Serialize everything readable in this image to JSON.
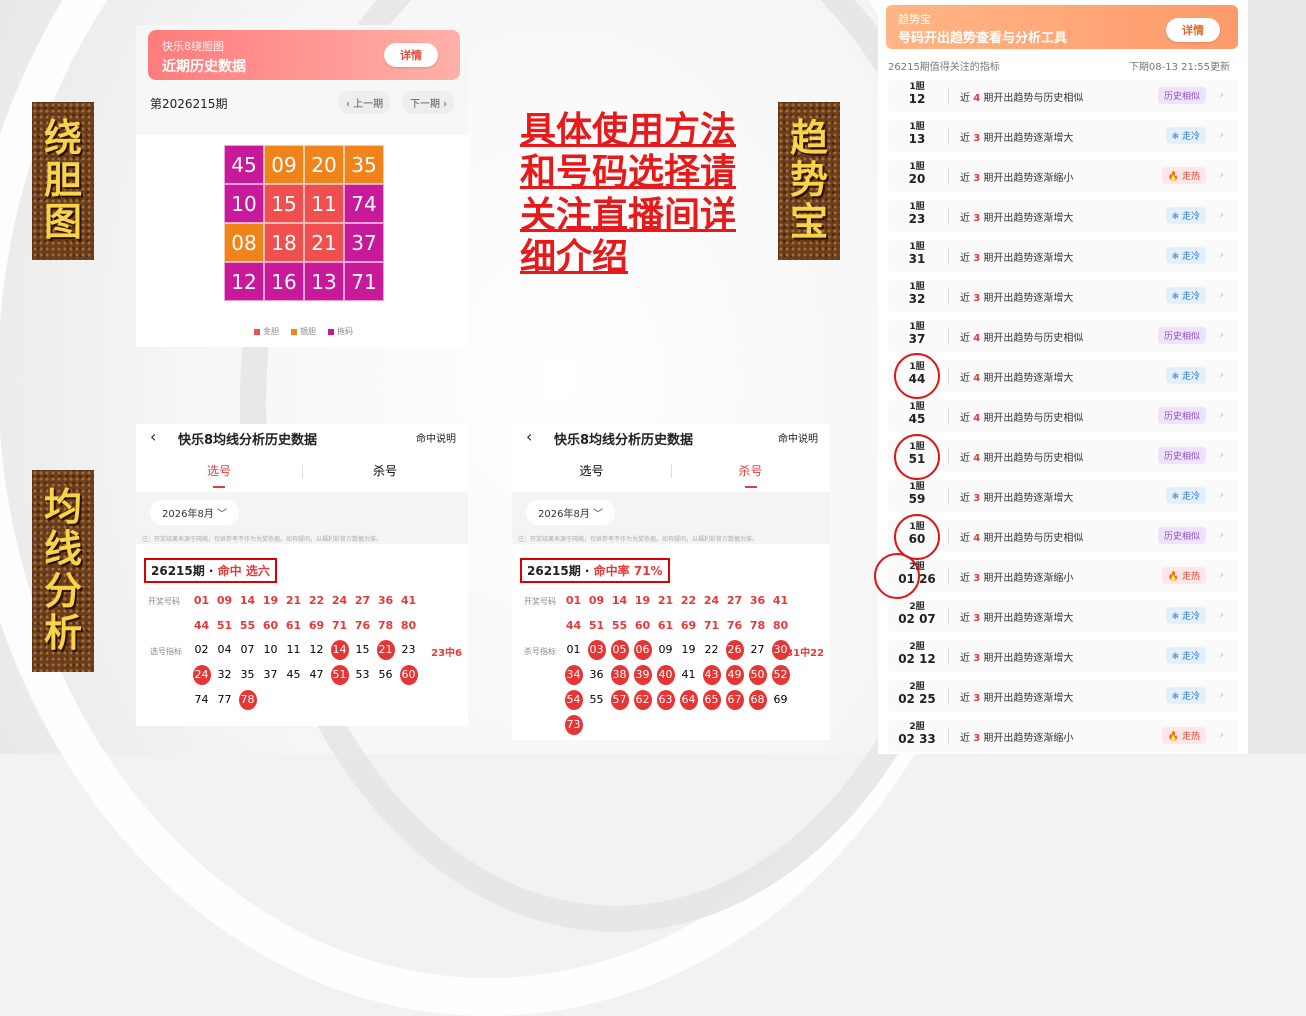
{
  "labels": {
    "left_top": [
      "绕",
      "胆",
      "图"
    ],
    "left_bottom": [
      "均",
      "线",
      "分",
      "析"
    ],
    "right_top": [
      "趋",
      "势",
      "宝"
    ]
  },
  "center_text": "具体使用方法和号码选择请关注直播间详细介绍",
  "dan_card": {
    "small_title": "快乐8绕胆图",
    "big_title": "近期历史数据",
    "detail_btn": "详情",
    "period": "第2026215期",
    "prev": "‹ 上一期",
    "next": "下一期 ›",
    "grid": [
      {
        "v": "45",
        "c": "#c8199a"
      },
      {
        "v": "09",
        "c": "#f0841a"
      },
      {
        "v": "20",
        "c": "#f0841a"
      },
      {
        "v": "35",
        "c": "#f0841a"
      },
      {
        "v": "10",
        "c": "#c8199a"
      },
      {
        "v": "15",
        "c": "#f04f4f"
      },
      {
        "v": "11",
        "c": "#f04f4f"
      },
      {
        "v": "74",
        "c": "#c8199a"
      },
      {
        "v": "08",
        "c": "#f0841a"
      },
      {
        "v": "18",
        "c": "#f04f4f"
      },
      {
        "v": "21",
        "c": "#f04f4f"
      },
      {
        "v": "37",
        "c": "#c8199a"
      },
      {
        "v": "12",
        "c": "#c8199a"
      },
      {
        "v": "16",
        "c": "#c8199a"
      },
      {
        "v": "13",
        "c": "#c8199a"
      },
      {
        "v": "71",
        "c": "#c8199a"
      }
    ],
    "legend": [
      {
        "label": "金胆",
        "color": "#f04f4f"
      },
      {
        "label": "银胆",
        "color": "#f0841a"
      },
      {
        "label": "拖码",
        "color": "#c8199a"
      }
    ]
  },
  "pick_panel": {
    "title": "快乐8均线分析历史数据",
    "help": "命中说明",
    "tab1": "选号",
    "tab2": "杀号",
    "month": "2026年8月 ﹀",
    "note": "注：开奖结果来源于网络，仅供参考不作为兑奖依据。如有疑问，以福利彩官方数据为准。",
    "result_prefix": "26215期 · ",
    "result_hit": "命中 选六",
    "open_label": "开奖号码",
    "index_label": "选号指标",
    "open_row1": [
      "01",
      "09",
      "14",
      "19",
      "21",
      "22",
      "24",
      "27",
      "36",
      "41"
    ],
    "open_row2": [
      "44",
      "51",
      "55",
      "60",
      "61",
      "69",
      "71",
      "76",
      "78",
      "80"
    ],
    "idx_row1": [
      {
        "v": "02"
      },
      {
        "v": "04"
      },
      {
        "v": "07"
      },
      {
        "v": "10"
      },
      {
        "v": "11"
      },
      {
        "v": "12"
      },
      {
        "v": "14",
        "b": 1
      },
      {
        "v": "15"
      },
      {
        "v": "21",
        "b": 1
      },
      {
        "v": "23"
      }
    ],
    "idx_row2": [
      {
        "v": "24",
        "b": 1
      },
      {
        "v": "32"
      },
      {
        "v": "35"
      },
      {
        "v": "37"
      },
      {
        "v": "45"
      },
      {
        "v": "47"
      },
      {
        "v": "51",
        "b": 1
      },
      {
        "v": "53"
      },
      {
        "v": "56"
      },
      {
        "v": "60",
        "b": 1
      }
    ],
    "idx_row3": [
      {
        "v": "74"
      },
      {
        "v": "77"
      },
      {
        "v": "78",
        "b": 1
      }
    ],
    "tail": "23中6"
  },
  "kill_panel": {
    "title": "快乐8均线分析历史数据",
    "help": "命中说明",
    "tab1": "选号",
    "tab2": "杀号",
    "month": "2026年8月 ﹀",
    "note": "注：开奖结果来源于网络，仅供参考不作为兑奖依据。如有疑问，以福利彩官方数据为准。",
    "result_prefix": "26215期 · ",
    "result_hit": "命中率 71%",
    "open_label": "开奖号码",
    "index_label": "杀号指标",
    "open_row1": [
      "01",
      "09",
      "14",
      "19",
      "21",
      "22",
      "24",
      "27",
      "36",
      "41"
    ],
    "open_row2": [
      "44",
      "51",
      "55",
      "60",
      "61",
      "69",
      "71",
      "76",
      "78",
      "80"
    ],
    "idx_row1": [
      {
        "v": "01"
      },
      {
        "v": "03",
        "b": 1
      },
      {
        "v": "05",
        "b": 1
      },
      {
        "v": "06",
        "b": 1
      },
      {
        "v": "09"
      },
      {
        "v": "19"
      },
      {
        "v": "22"
      },
      {
        "v": "26",
        "b": 1
      },
      {
        "v": "27"
      },
      {
        "v": "30",
        "b": 1
      }
    ],
    "idx_row2": [
      {
        "v": "34",
        "b": 1
      },
      {
        "v": "36"
      },
      {
        "v": "38",
        "b": 1
      },
      {
        "v": "39",
        "b": 1
      },
      {
        "v": "40",
        "b": 1
      },
      {
        "v": "41"
      },
      {
        "v": "43",
        "b": 1
      },
      {
        "v": "49",
        "b": 1
      },
      {
        "v": "50",
        "b": 1
      },
      {
        "v": "52",
        "b": 1
      }
    ],
    "idx_row3": [
      {
        "v": "54",
        "b": 1
      },
      {
        "v": "55"
      },
      {
        "v": "57",
        "b": 1
      },
      {
        "v": "62",
        "b": 1
      },
      {
        "v": "63",
        "b": 1
      },
      {
        "v": "64",
        "b": 1
      },
      {
        "v": "65",
        "b": 1
      },
      {
        "v": "67",
        "b": 1
      },
      {
        "v": "68",
        "b": 1
      },
      {
        "v": "69"
      }
    ],
    "idx_row4": [
      {
        "v": "73",
        "b": 1
      }
    ],
    "tail": "31中22"
  },
  "trend": {
    "small_title": "趋势宝",
    "big_title": "号码开出趋势查看与分析工具",
    "detail_btn": "详情",
    "sub_left": "26215期值得关注的指标",
    "sub_right": "下期08-13 21:55更新",
    "rows": [
      {
        "dan": "1胆",
        "n": "12",
        "p1": "近 ",
        "k": "4",
        "p2": " 期开出趋势与历史相似",
        "tag": "历史相似",
        "cls": "similar"
      },
      {
        "dan": "1胆",
        "n": "13",
        "p1": "近 ",
        "k": "3",
        "p2": " 期开出趋势逐渐增大",
        "tag": "❄ 走冷",
        "cls": "cold"
      },
      {
        "dan": "1胆",
        "n": "20",
        "p1": "近 ",
        "k": "3",
        "p2": " 期开出趋势逐渐缩小",
        "tag": "🔥 走热",
        "cls": "hot"
      },
      {
        "dan": "1胆",
        "n": "23",
        "p1": "近 ",
        "k": "3",
        "p2": " 期开出趋势逐渐增大",
        "tag": "❄ 走冷",
        "cls": "cold"
      },
      {
        "dan": "1胆",
        "n": "31",
        "p1": "近 ",
        "k": "3",
        "p2": " 期开出趋势逐渐增大",
        "tag": "❄ 走冷",
        "cls": "cold"
      },
      {
        "dan": "1胆",
        "n": "32",
        "p1": "近 ",
        "k": "3",
        "p2": " 期开出趋势逐渐增大",
        "tag": "❄ 走冷",
        "cls": "cold"
      },
      {
        "dan": "1胆",
        "n": "37",
        "p1": "近 ",
        "k": "4",
        "p2": " 期开出趋势与历史相似",
        "tag": "历史相似",
        "cls": "similar"
      },
      {
        "dan": "1胆",
        "n": "44",
        "p1": "近 ",
        "k": "4",
        "p2": " 期开出趋势逐渐增大",
        "tag": "❄ 走冷",
        "cls": "cold"
      },
      {
        "dan": "1胆",
        "n": "45",
        "p1": "近 ",
        "k": "4",
        "p2": " 期开出趋势与历史相似",
        "tag": "历史相似",
        "cls": "similar"
      },
      {
        "dan": "1胆",
        "n": "51",
        "p1": "近 ",
        "k": "4",
        "p2": " 期开出趋势与历史相似",
        "tag": "历史相似",
        "cls": "similar"
      },
      {
        "dan": "1胆",
        "n": "59",
        "p1": "近 ",
        "k": "3",
        "p2": " 期开出趋势逐渐增大",
        "tag": "❄ 走冷",
        "cls": "cold"
      },
      {
        "dan": "1胆",
        "n": "60",
        "p1": "近 ",
        "k": "4",
        "p2": " 期开出趋势与历史相似",
        "tag": "历史相似",
        "cls": "similar"
      },
      {
        "dan": "2胆",
        "n": "01 26",
        "p1": "近 ",
        "k": "3",
        "p2": " 期开出趋势逐渐缩小",
        "tag": "🔥 走热",
        "cls": "hot"
      },
      {
        "dan": "2胆",
        "n": "02 07",
        "p1": "近 ",
        "k": "3",
        "p2": " 期开出趋势逐渐增大",
        "tag": "❄ 走冷",
        "cls": "cold"
      },
      {
        "dan": "2胆",
        "n": "02 12",
        "p1": "近 ",
        "k": "3",
        "p2": " 期开出趋势逐渐增大",
        "tag": "❄ 走冷",
        "cls": "cold"
      },
      {
        "dan": "2胆",
        "n": "02 25",
        "p1": "近 ",
        "k": "3",
        "p2": " 期开出趋势逐渐增大",
        "tag": "❄ 走冷",
        "cls": "cold"
      },
      {
        "dan": "2胆",
        "n": "02 33",
        "p1": "近 ",
        "k": "3",
        "p2": " 期开出趋势逐渐缩小",
        "tag": "🔥 走热",
        "cls": "hot"
      }
    ]
  }
}
